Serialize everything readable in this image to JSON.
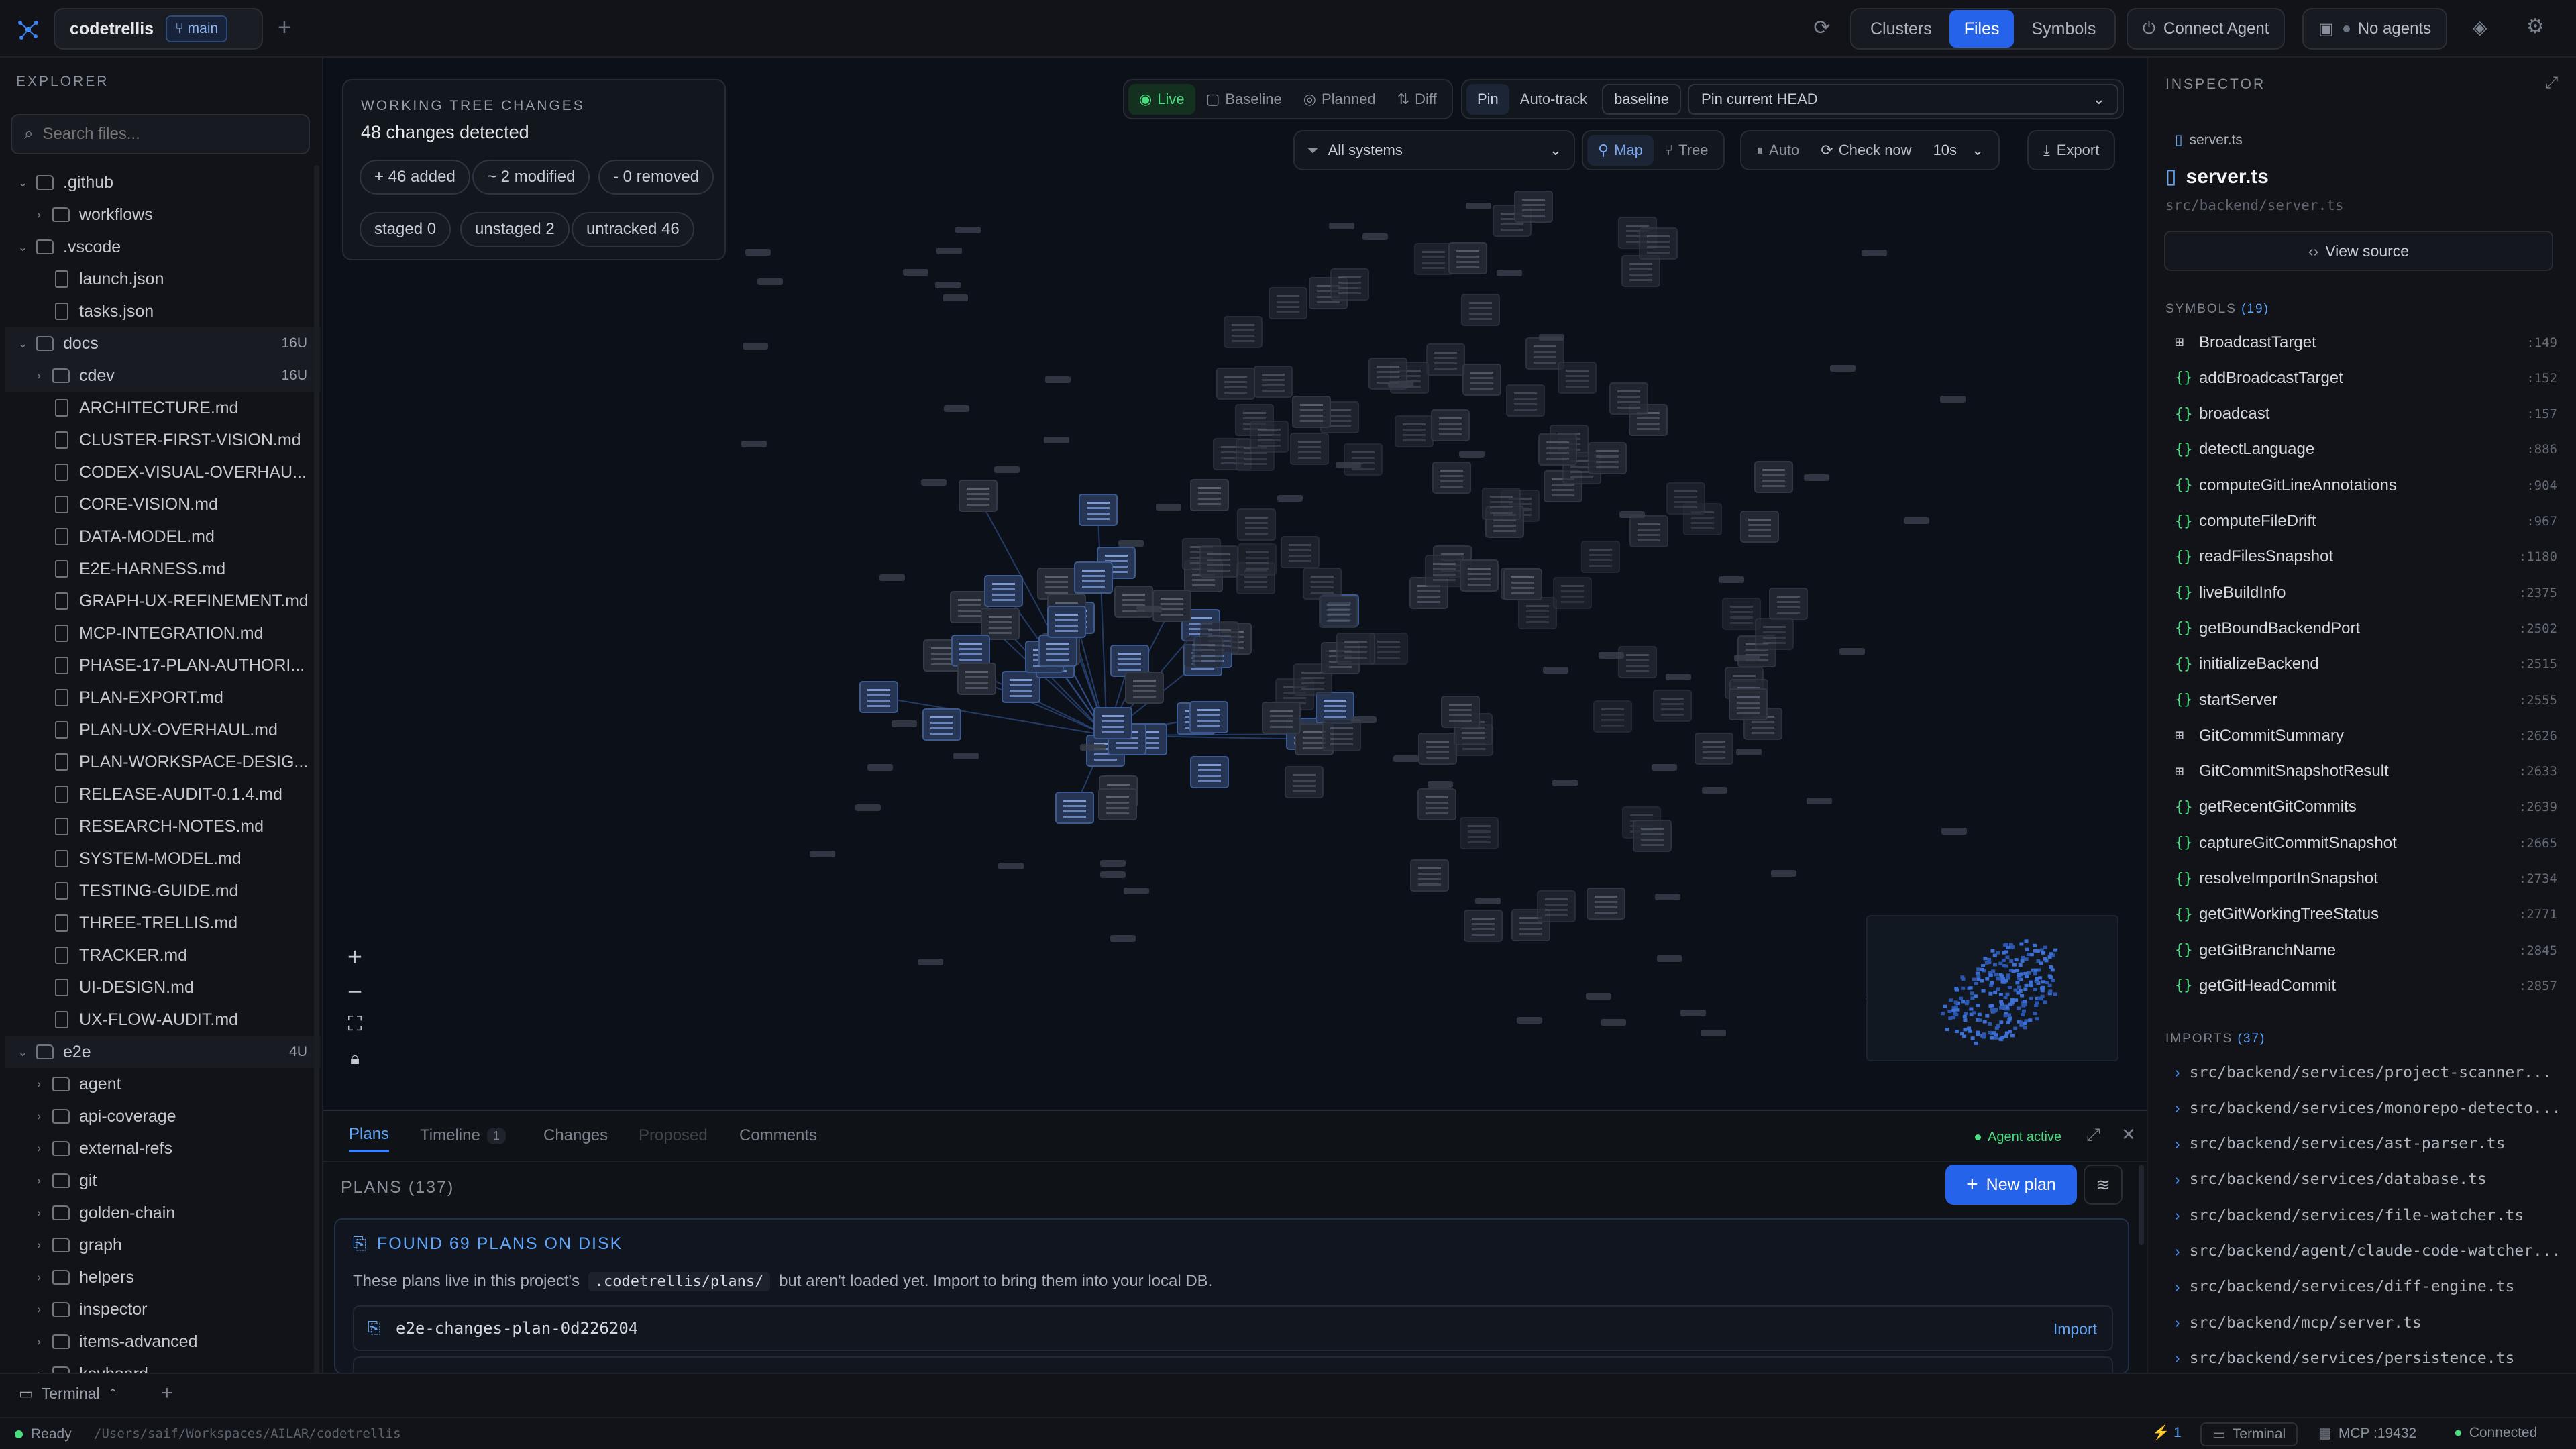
{
  "titlebar": {
    "project": "codetrellis",
    "branch": "main",
    "view_tabs": [
      "Clusters",
      "Files",
      "Symbols"
    ],
    "active_view": "Files",
    "connect_agent": "Connect Agent",
    "agents_status": "No agents"
  },
  "explorer": {
    "title": "EXPLORER",
    "search_placeholder": "Search files...",
    "items": [
      {
        "label": ".github",
        "kind": "folder",
        "depth": 0,
        "open": true,
        "badge": ""
      },
      {
        "label": "workflows",
        "kind": "folder",
        "depth": 1,
        "open": false,
        "badge": ""
      },
      {
        "label": ".vscode",
        "kind": "folder",
        "depth": 0,
        "open": true,
        "badge": ""
      },
      {
        "label": "launch.json",
        "kind": "file",
        "depth": 1,
        "badge": ""
      },
      {
        "label": "tasks.json",
        "kind": "file",
        "depth": 1,
        "badge": ""
      },
      {
        "label": "docs",
        "kind": "folder",
        "depth": 0,
        "open": true,
        "badge": "16U"
      },
      {
        "label": "cdev",
        "kind": "folder",
        "depth": 1,
        "open": false,
        "badge": "16U"
      },
      {
        "label": "ARCHITECTURE.md",
        "kind": "file",
        "depth": 1,
        "badge": ""
      },
      {
        "label": "CLUSTER-FIRST-VISION.md",
        "kind": "file",
        "depth": 1,
        "badge": ""
      },
      {
        "label": "CODEX-VISUAL-OVERHAU...",
        "kind": "file",
        "depth": 1,
        "badge": ""
      },
      {
        "label": "CORE-VISION.md",
        "kind": "file",
        "depth": 1,
        "badge": ""
      },
      {
        "label": "DATA-MODEL.md",
        "kind": "file",
        "depth": 1,
        "badge": ""
      },
      {
        "label": "E2E-HARNESS.md",
        "kind": "file",
        "depth": 1,
        "badge": ""
      },
      {
        "label": "GRAPH-UX-REFINEMENT.md",
        "kind": "file",
        "depth": 1,
        "badge": ""
      },
      {
        "label": "MCP-INTEGRATION.md",
        "kind": "file",
        "depth": 1,
        "badge": ""
      },
      {
        "label": "PHASE-17-PLAN-AUTHORI...",
        "kind": "file",
        "depth": 1,
        "badge": ""
      },
      {
        "label": "PLAN-EXPORT.md",
        "kind": "file",
        "depth": 1,
        "badge": ""
      },
      {
        "label": "PLAN-UX-OVERHAUL.md",
        "kind": "file",
        "depth": 1,
        "badge": ""
      },
      {
        "label": "PLAN-WORKSPACE-DESIG...",
        "kind": "file",
        "depth": 1,
        "badge": ""
      },
      {
        "label": "RELEASE-AUDIT-0.1.4.md",
        "kind": "file",
        "depth": 1,
        "badge": ""
      },
      {
        "label": "RESEARCH-NOTES.md",
        "kind": "file",
        "depth": 1,
        "badge": ""
      },
      {
        "label": "SYSTEM-MODEL.md",
        "kind": "file",
        "depth": 1,
        "badge": ""
      },
      {
        "label": "TESTING-GUIDE.md",
        "kind": "file",
        "depth": 1,
        "badge": ""
      },
      {
        "label": "THREE-TRELLIS.md",
        "kind": "file",
        "depth": 1,
        "badge": ""
      },
      {
        "label": "TRACKER.md",
        "kind": "file",
        "depth": 1,
        "badge": ""
      },
      {
        "label": "UI-DESIGN.md",
        "kind": "file",
        "depth": 1,
        "badge": ""
      },
      {
        "label": "UX-FLOW-AUDIT.md",
        "kind": "file",
        "depth": 1,
        "badge": ""
      },
      {
        "label": "e2e",
        "kind": "folder",
        "depth": 0,
        "open": true,
        "badge": "4U"
      },
      {
        "label": "agent",
        "kind": "folder",
        "depth": 1,
        "open": false,
        "badge": ""
      },
      {
        "label": "api-coverage",
        "kind": "folder",
        "depth": 1,
        "open": false,
        "badge": ""
      },
      {
        "label": "external-refs",
        "kind": "folder",
        "depth": 1,
        "open": false,
        "badge": ""
      },
      {
        "label": "git",
        "kind": "folder",
        "depth": 1,
        "open": false,
        "badge": ""
      },
      {
        "label": "golden-chain",
        "kind": "folder",
        "depth": 1,
        "open": false,
        "badge": ""
      },
      {
        "label": "graph",
        "kind": "folder",
        "depth": 1,
        "open": false,
        "badge": ""
      },
      {
        "label": "helpers",
        "kind": "folder",
        "depth": 1,
        "open": false,
        "badge": ""
      },
      {
        "label": "inspector",
        "kind": "folder",
        "depth": 1,
        "open": false,
        "badge": ""
      },
      {
        "label": "items-advanced",
        "kind": "folder",
        "depth": 1,
        "open": false,
        "badge": ""
      },
      {
        "label": "keyboard",
        "kind": "folder",
        "depth": 1,
        "open": false,
        "badge": ""
      }
    ]
  },
  "changes": {
    "title": "WORKING TREE CHANGES",
    "summary": "48 changes detected",
    "added": "+ 46 added",
    "modified": "~ 2 modified",
    "removed": "- 0 removed",
    "staged": "staged 0",
    "unstaged": "unstaged 2",
    "untracked": "untracked 46"
  },
  "graph_toolbar": {
    "live": "Live",
    "baseline": "Baseline",
    "planned": "Planned",
    "diff": "Diff",
    "pin": "Pin",
    "auto_track": "Auto-track",
    "baseline_chip": "baseline",
    "pin_select": "Pin current HEAD",
    "systems_select": "All systems",
    "map": "Map",
    "tree": "Tree",
    "auto": "Auto",
    "check_now": "Check now",
    "interval": "10s",
    "export": "Export"
  },
  "inspector": {
    "title": "INSPECTOR",
    "crumb": "server.ts",
    "file_name": "server.ts",
    "file_path": "src/backend/server.ts",
    "view_source": "View source",
    "symbols_label": "SYMBOLS",
    "symbols_count": "(19)",
    "symbols": [
      {
        "name": "BroadcastTarget",
        "kind": "type",
        "line": ":149"
      },
      {
        "name": "addBroadcastTarget",
        "kind": "fn",
        "line": ":152"
      },
      {
        "name": "broadcast",
        "kind": "fn",
        "line": ":157"
      },
      {
        "name": "detectLanguage",
        "kind": "fn",
        "line": ":886"
      },
      {
        "name": "computeGitLineAnnotations",
        "kind": "fn",
        "line": ":904"
      },
      {
        "name": "computeFileDrift",
        "kind": "fn",
        "line": ":967"
      },
      {
        "name": "readFilesSnapshot",
        "kind": "fn",
        "line": ":1180"
      },
      {
        "name": "liveBuildInfo",
        "kind": "fn",
        "line": ":2375"
      },
      {
        "name": "getBoundBackendPort",
        "kind": "fn",
        "line": ":2502"
      },
      {
        "name": "initializeBackend",
        "kind": "fn",
        "line": ":2515"
      },
      {
        "name": "startServer",
        "kind": "fn",
        "line": ":2555"
      },
      {
        "name": "GitCommitSummary",
        "kind": "type",
        "line": ":2626"
      },
      {
        "name": "GitCommitSnapshotResult",
        "kind": "type",
        "line": ":2633"
      },
      {
        "name": "getRecentGitCommits",
        "kind": "fn",
        "line": ":2639"
      },
      {
        "name": "captureGitCommitSnapshot",
        "kind": "fn",
        "line": ":2665"
      },
      {
        "name": "resolveImportInSnapshot",
        "kind": "fn",
        "line": ":2734"
      },
      {
        "name": "getGitWorkingTreeStatus",
        "kind": "fn",
        "line": ":2771"
      },
      {
        "name": "getGitBranchName",
        "kind": "fn",
        "line": ":2845"
      },
      {
        "name": "getGitHeadCommit",
        "kind": "fn",
        "line": ":2857"
      }
    ],
    "imports_label": "IMPORTS",
    "imports_count": "(37)",
    "imports": [
      "src/backend/services/project-scanner...",
      "src/backend/services/monorepo-detecto...",
      "src/backend/services/ast-parser.ts",
      "src/backend/services/database.ts",
      "src/backend/services/file-watcher.ts",
      "src/backend/agent/claude-code-watcher...",
      "src/backend/services/diff-engine.ts",
      "src/backend/mcp/server.ts",
      "src/backend/services/persistence.ts"
    ]
  },
  "plans": {
    "tabs": [
      "Plans",
      "Timeline",
      "Changes",
      "Proposed",
      "Comments"
    ],
    "timeline_count": "1",
    "agent_status": "Agent active",
    "heading": "PLANS (137)",
    "new_plan": "New plan",
    "disk_title": "FOUND 69 PLANS ON DISK",
    "disk_text_before": "These plans live in this project's",
    "disk_path": ".codetrellis/plans/",
    "disk_text_after": "but aren't loaded yet. Import to bring them into your local DB.",
    "plan_item": "e2e-changes-plan-0d226204",
    "import_label": "Import"
  },
  "terminal": {
    "label": "Terminal"
  },
  "status": {
    "ready": "Ready",
    "path": "/Users/saif/Workspaces/AILAR/codetrellis",
    "count": "1",
    "terminal": "Terminal",
    "mcp": "MCP :19432",
    "connected": "Connected"
  },
  "colors": {
    "accent": "#2563eb",
    "live": "#4ade80",
    "link": "#4b8df8"
  }
}
